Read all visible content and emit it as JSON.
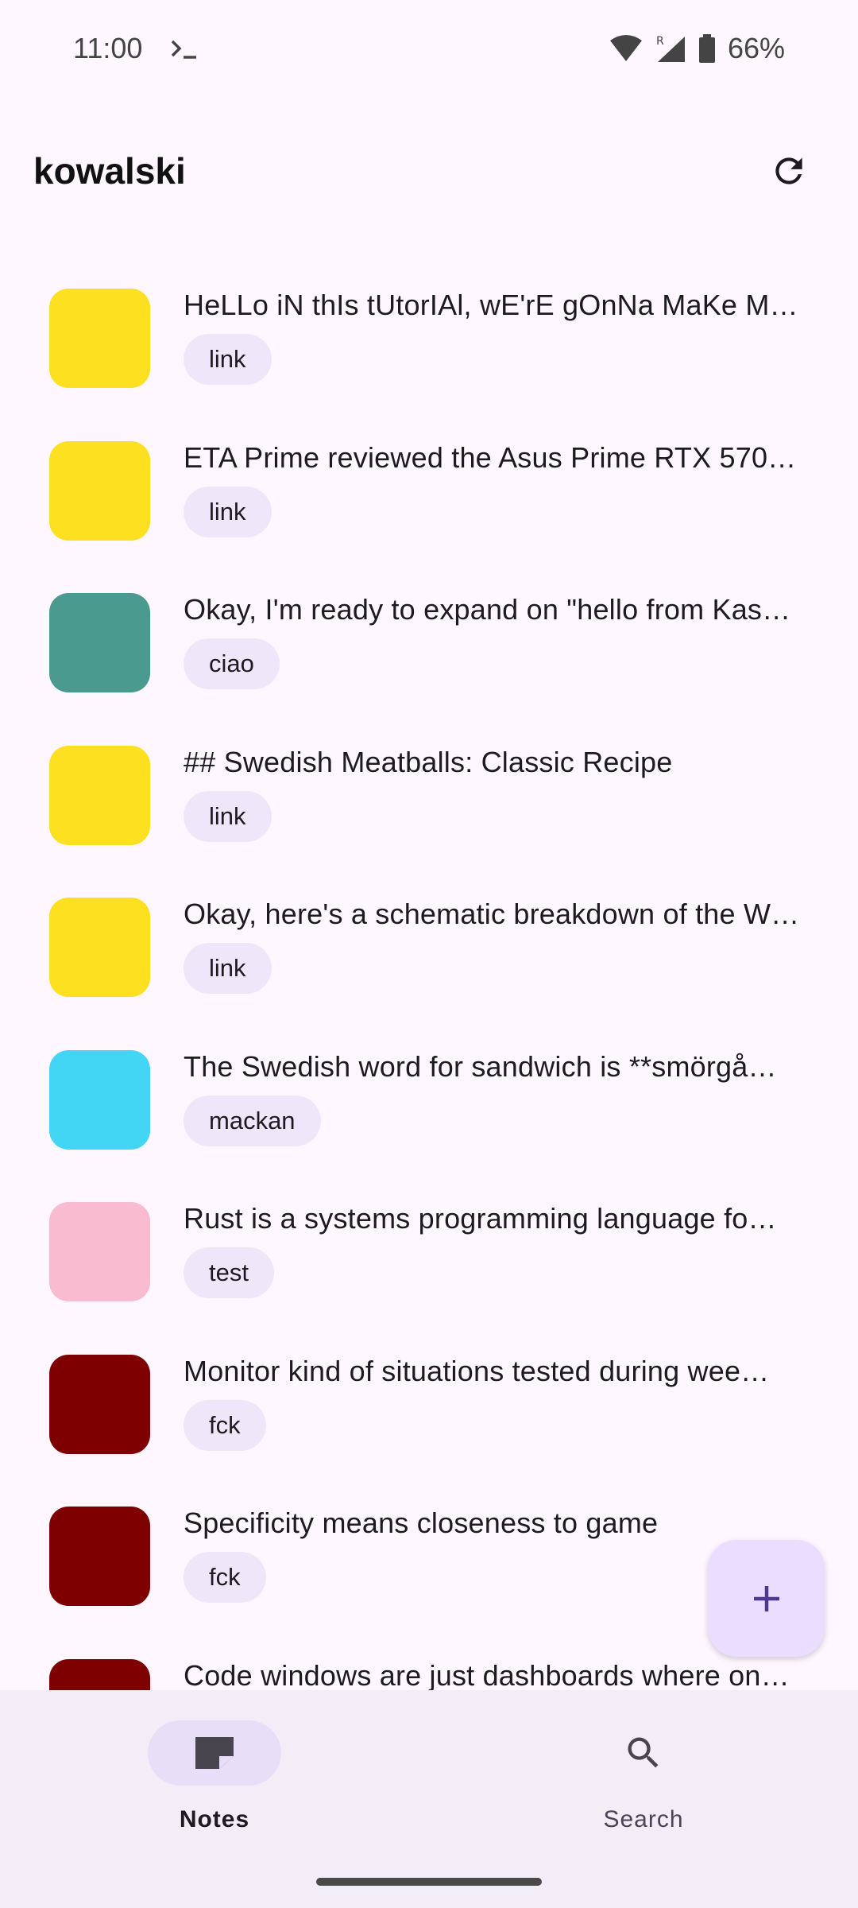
{
  "status_bar": {
    "time": "11:00",
    "terminal_icon": "terminal-icon",
    "battery": "66%",
    "icons": [
      "wifi-icon",
      "signal-icon",
      "battery-icon"
    ]
  },
  "app_bar": {
    "title": "kowalski",
    "refresh_icon": "refresh-icon"
  },
  "notes": [
    {
      "title": "HeLLo iN thIs tUtorIAl, wE'rE gOnNa MaKe M…",
      "tag": "link",
      "color": "#fde01f"
    },
    {
      "title": "ETA Prime reviewed the Asus Prime RTX 570…",
      "tag": "link",
      "color": "#fde01f"
    },
    {
      "title": "Okay, I'm ready to expand on \"hello from Kas…",
      "tag": "ciao",
      "color": "#4a9a8f"
    },
    {
      "title": "## Swedish Meatballs: Classic Recipe",
      "tag": "link",
      "color": "#fde01f"
    },
    {
      "title": "Okay, here's a schematic breakdown of the W…",
      "tag": "link",
      "color": "#fde01f"
    },
    {
      "title": "The Swedish word for sandwich is **smörgå…",
      "tag": "mackan",
      "color": "#42d6f4"
    },
    {
      "title": "Rust is a systems programming language fo…",
      "tag": "test",
      "color": "#f8bbd0"
    },
    {
      "title": "Monitor kind of situations tested during wee…",
      "tag": "fck",
      "color": "#7f0000"
    },
    {
      "title": "Specificity means closeness to game",
      "tag": "fck",
      "color": "#7f0000"
    },
    {
      "title": "Code windows are just dashboards where on…",
      "tag": "",
      "color": "#7f0000"
    }
  ],
  "fab": {
    "icon": "plus-icon",
    "color": "#eaddff"
  },
  "bottom_nav": {
    "items": [
      {
        "label": "Notes",
        "icon": "note-icon",
        "selected": true
      },
      {
        "label": "Search",
        "icon": "search-icon",
        "selected": false
      }
    ]
  }
}
